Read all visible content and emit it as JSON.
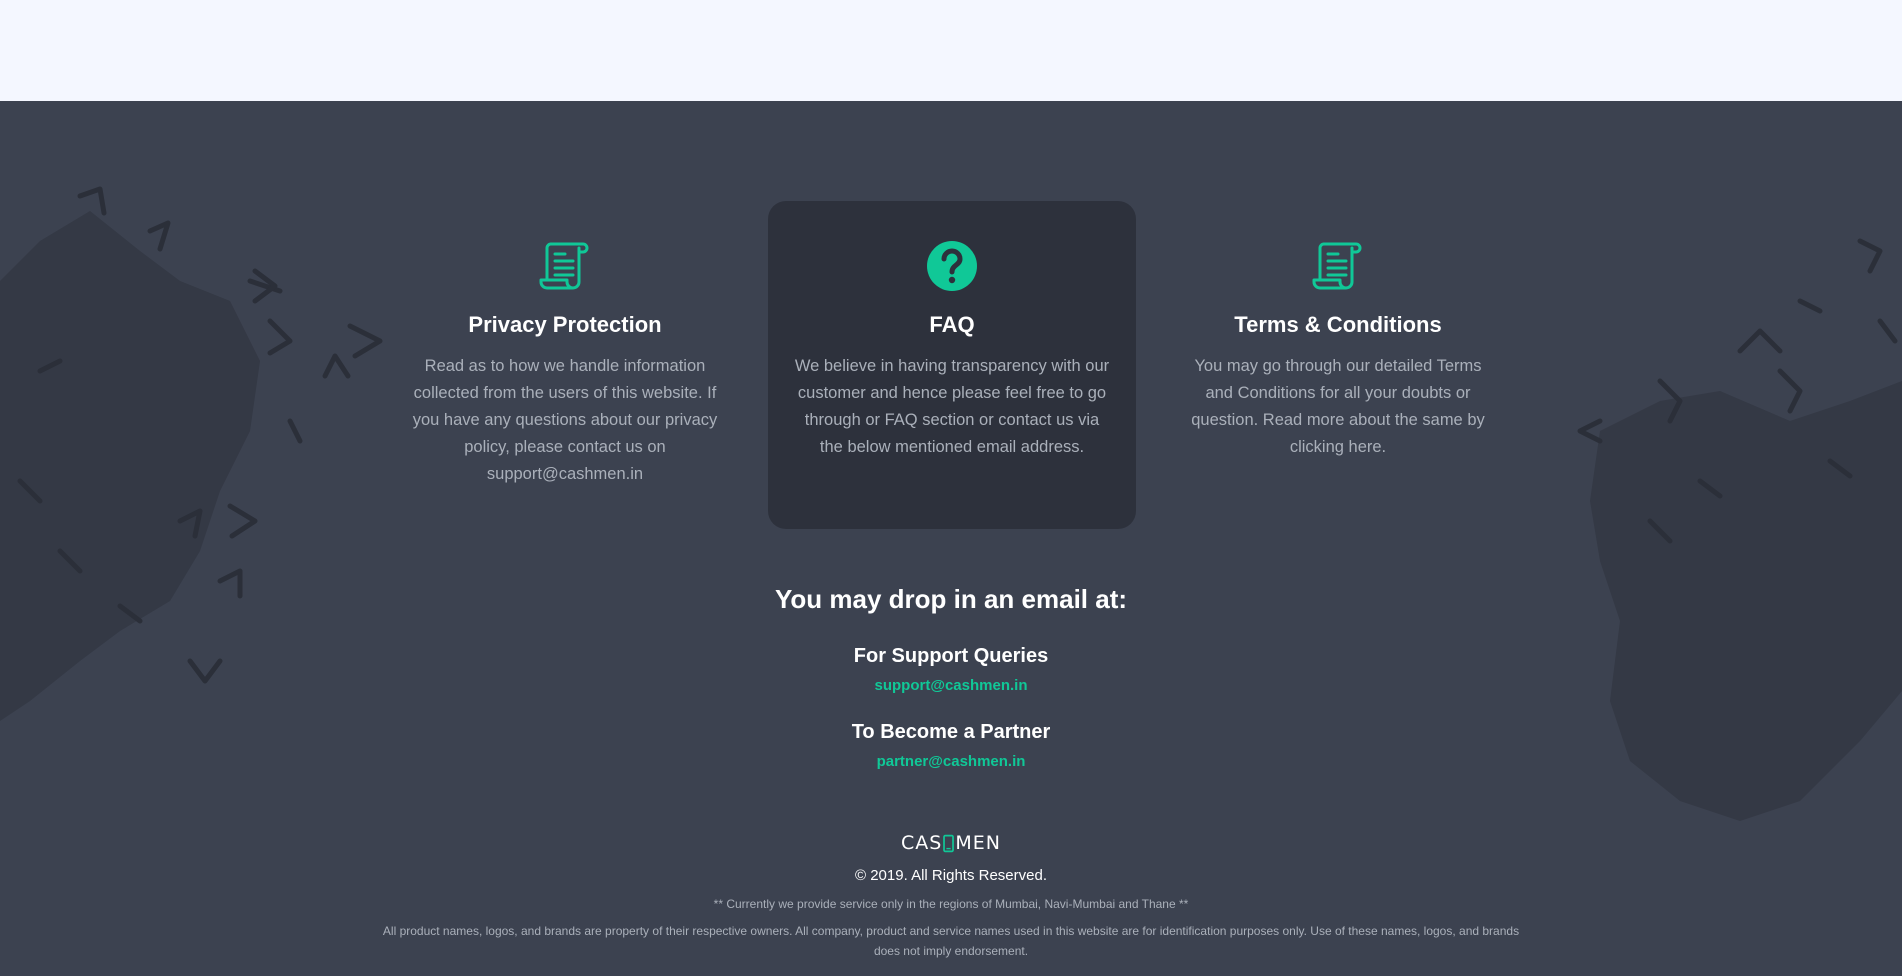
{
  "colors": {
    "accent": "#10c897",
    "footer_bg": "#3c4250",
    "card_highlight_bg": "#2d313c",
    "top_band_bg": "#f4f7ff",
    "muted_text": "#aab0ba"
  },
  "cards": [
    {
      "icon": "scroll-document-icon",
      "title": "Privacy Protection",
      "text": "Read as to how we handle information collected from the users of this website. If you have any questions about our privacy policy, please contact us on support@cashmen.in"
    },
    {
      "icon": "question-circle-icon",
      "title": "FAQ",
      "text": "We believe in having transparency with our customer and hence please feel free to go through or FAQ section or contact us via the below mentioned email address."
    },
    {
      "icon": "scroll-document-icon",
      "title": "Terms & Conditions",
      "text": "You may go through our detailed Terms and Conditions for all your doubts or question. Read more about the same by clicking here."
    }
  ],
  "contact": {
    "heading": "You may drop in an email at:",
    "support_label": "For Support Queries",
    "support_email": "support@cashmen.in",
    "partner_label": "To Become a Partner",
    "partner_email": "partner@cashmen.in"
  },
  "footer": {
    "logo_left": "CAS",
    "logo_right": "MEN",
    "copyright": "© 2019. All Rights Reserved.",
    "region_note": "** Currently we provide service only in the regions of Mumbai, Navi-Mumbai and Thane **",
    "disclaimer": "All product names, logos, and brands are property of their respective owners. All company, product and service names used in this website are for identification purposes only. Use of these names, logos, and brands does not imply endorsement."
  }
}
